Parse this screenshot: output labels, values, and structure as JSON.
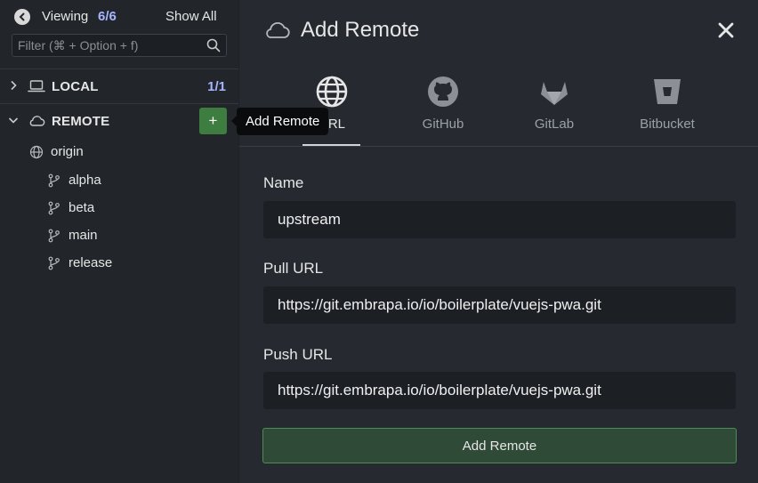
{
  "sidebar": {
    "viewing_label": "Viewing",
    "viewing_count": "6/6",
    "show_all": "Show All",
    "filter_placeholder": "Filter (⌘ + Option + f)",
    "local": {
      "label": "LOCAL",
      "count": "1/1"
    },
    "remote": {
      "label": "REMOTE",
      "add_symbol": "+",
      "tooltip": "Add Remote"
    },
    "remotes": [
      {
        "name": "origin",
        "branches": [
          "alpha",
          "beta",
          "main",
          "release"
        ]
      }
    ]
  },
  "dialog": {
    "title": "Add Remote",
    "tabs": [
      {
        "label": "URL",
        "icon": "globe-icon",
        "active": true
      },
      {
        "label": "GitHub",
        "icon": "github-icon",
        "active": false
      },
      {
        "label": "GitLab",
        "icon": "gitlab-icon",
        "active": false
      },
      {
        "label": "Bitbucket",
        "icon": "bitbucket-icon",
        "active": false
      }
    ],
    "name_label": "Name",
    "name_value": "upstream",
    "pull_label": "Pull URL",
    "pull_value": "https://git.embrapa.io/io/boilerplate/vuejs-pwa.git",
    "push_label": "Push URL",
    "push_value": "https://git.embrapa.io/io/boilerplate/vuejs-pwa.git",
    "submit_label": "Add Remote"
  },
  "colors": {
    "accent_count": "#a6b5ff",
    "add_button": "#3d7d3f",
    "submit_border": "#4b8d55"
  }
}
